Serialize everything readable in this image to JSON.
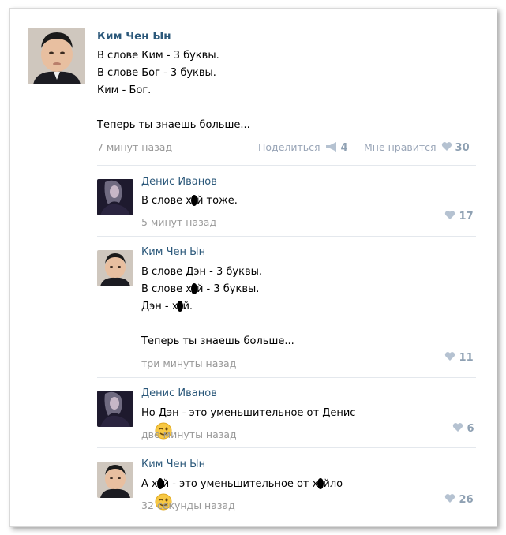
{
  "post": {
    "author": "Ким Чен Ын",
    "lines": [
      "В слове Ким - 3 буквы.",
      "В слове Бог - 3 буквы.",
      "Ким - Бог.",
      "",
      "Теперь ты знаешь больше..."
    ],
    "time": "7 минут назад",
    "share_label": "Поделиться",
    "share_count": "4",
    "like_label": "Мне нравится",
    "like_count": "30"
  },
  "comments": [
    {
      "author": "Денис Иванов",
      "text_a": "В слове х",
      "text_b": "й тоже.",
      "time": "5 минут назад",
      "likes": "17"
    },
    {
      "author": "Ким Чен Ын",
      "line1": "В слове Дэн - 3 буквы.",
      "line2a": "В слове х",
      "line2b": "й - 3 буквы.",
      "line3a": "Дэн - х",
      "line3b": "й.",
      "line5": "Теперь ты знаешь больше...",
      "time": "три минуты назад",
      "likes": "11"
    },
    {
      "author": "Денис Иванов",
      "text": "Но Дэн - это уменьшительное от Денис",
      "time": "две минуты назад",
      "likes": "6"
    },
    {
      "author": "Ким Чен Ын",
      "text_a": "А х",
      "text_b": "й - это уменьшительное от х",
      "text_c": "йло",
      "time": "32 секунды назад",
      "likes": "26"
    }
  ],
  "colors": {
    "link": "#2b587a",
    "muted": "#999999",
    "like": "#8fa1b3"
  }
}
